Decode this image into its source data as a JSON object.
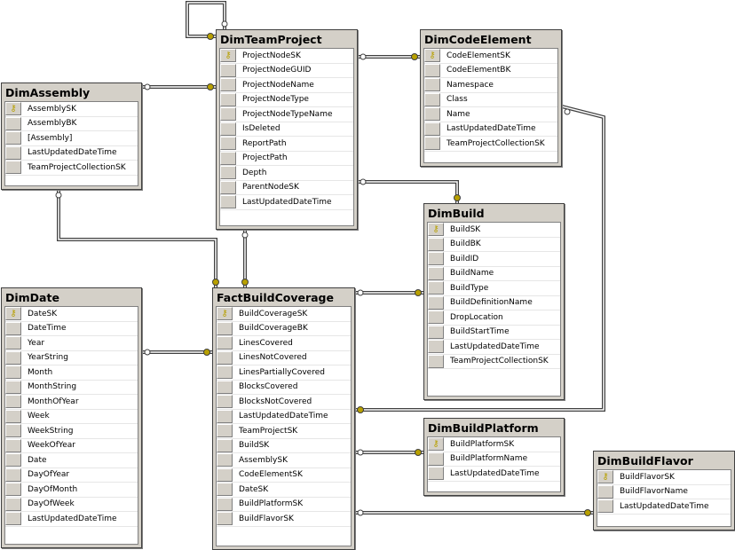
{
  "tables": [
    {
      "id": "dimteamproject",
      "name": "DimTeamProject",
      "columns": [
        "ProjectNodeSK",
        "ProjectNodeGUID",
        "ProjectNodeName",
        "ProjectNodeType",
        "ProjectNodeTypeName",
        "IsDeleted",
        "ReportPath",
        "ProjectPath",
        "Depth",
        "ParentNodeSK",
        "LastUpdatedDateTime"
      ],
      "keys": [
        "ProjectNodeSK"
      ]
    },
    {
      "id": "dimcodeelement",
      "name": "DimCodeElement",
      "columns": [
        "CodeElementSK",
        "CodeElementBK",
        "Namespace",
        "Class",
        "Name",
        "LastUpdatedDateTime",
        "TeamProjectCollectionSK"
      ],
      "keys": [
        "CodeElementSK"
      ]
    },
    {
      "id": "dimassembly",
      "name": "DimAssembly",
      "columns": [
        "AssemblySK",
        "AssemblyBK",
        "[Assembly]",
        "LastUpdatedDateTime",
        "TeamProjectCollectionSK"
      ],
      "keys": [
        "AssemblySK"
      ]
    },
    {
      "id": "dimbuild",
      "name": "DimBuild",
      "columns": [
        "BuildSK",
        "BuildBK",
        "BuildID",
        "BuildName",
        "BuildType",
        "BuildDefinitionName",
        "DropLocation",
        "BuildStartTime",
        "LastUpdatedDateTime",
        "TeamProjectCollectionSK"
      ],
      "keys": [
        "BuildSK"
      ]
    },
    {
      "id": "dimdate",
      "name": "DimDate",
      "columns": [
        "DateSK",
        "DateTime",
        "Year",
        "YearString",
        "Month",
        "MonthString",
        "MonthOfYear",
        "Week",
        "WeekString",
        "WeekOfYear",
        "Date",
        "DayOfYear",
        "DayOfMonth",
        "DayOfWeek",
        "LastUpdatedDateTime"
      ],
      "keys": [
        "DateSK"
      ]
    },
    {
      "id": "factbuildcoverage",
      "name": "FactBuildCoverage",
      "columns": [
        "BuildCoverageSK",
        "BuildCoverageBK",
        "LinesCovered",
        "LinesNotCovered",
        "LinesPartiallyCovered",
        "BlocksCovered",
        "BlocksNotCovered",
        "LastUpdatedDateTime",
        "TeamProjectSK",
        "BuildSK",
        "AssemblySK",
        "CodeElementSK",
        "DateSK",
        "BuildPlatformSK",
        "BuildFlavorSK"
      ],
      "keys": [
        "BuildCoverageSK"
      ]
    },
    {
      "id": "dimbuildplatform",
      "name": "DimBuildPlatform",
      "columns": [
        "BuildPlatformSK",
        "BuildPlatformName",
        "LastUpdatedDateTime"
      ],
      "keys": [
        "BuildPlatformSK"
      ]
    },
    {
      "id": "dimbuildflavor",
      "name": "DimBuildFlavor",
      "columns": [
        "BuildFlavorSK",
        "BuildFlavorName",
        "LastUpdatedDateTime"
      ],
      "keys": [
        "BuildFlavorSK"
      ]
    }
  ],
  "relationships": [
    {
      "from": "dimteamproject",
      "to": "dimteamproject"
    },
    {
      "from": "dimassembly",
      "to": "dimteamproject"
    },
    {
      "from": "dimcodeelement",
      "to": "dimteamproject"
    },
    {
      "from": "dimbuild",
      "to": "dimteamproject"
    },
    {
      "from": "factbuildcoverage",
      "to": "dimcodeelement"
    },
    {
      "from": "factbuildcoverage",
      "to": "dimassembly"
    },
    {
      "from": "factbuildcoverage",
      "to": "dimteamproject"
    },
    {
      "from": "factbuildcoverage",
      "to": "dimdate"
    },
    {
      "from": "factbuildcoverage",
      "to": "dimbuild"
    },
    {
      "from": "factbuildcoverage",
      "to": "dimbuildplatform"
    },
    {
      "from": "factbuildcoverage",
      "to": "dimbuildflavor"
    }
  ],
  "colors": {
    "key": "#b8a000",
    "line": "#505050",
    "header": "#d4d0c8"
  }
}
